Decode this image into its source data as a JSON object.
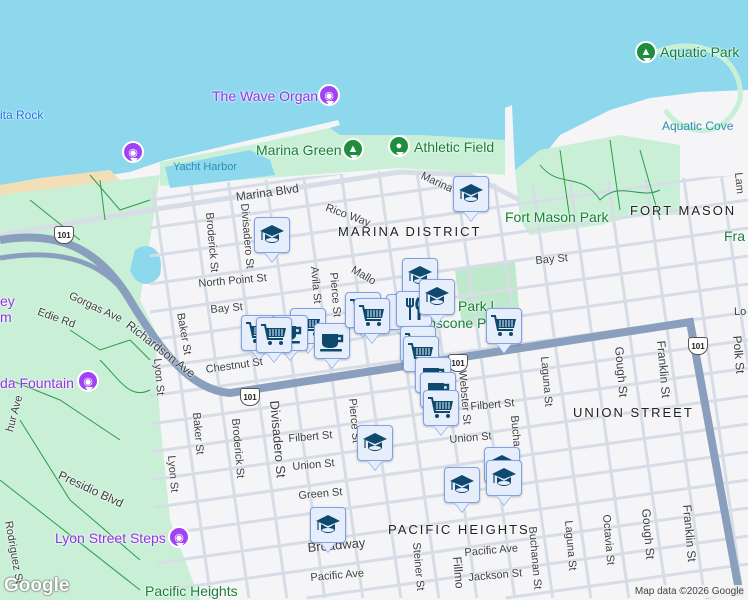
{
  "map": {
    "colors": {
      "water": "#8ed8ee",
      "land": "#f5f4f6",
      "park": "#c9f0d6",
      "street": "#d6dde6",
      "highway": "#8a9fbd",
      "marker_bg": "#e6edfb",
      "marker_border": "#7fa2e6",
      "marker_icon": "#0f4a6e"
    },
    "pois": {
      "bonita_rock": "ita Rock",
      "wave_organ": "The Wave Organ",
      "yacht_harbor": "Yacht Harbor",
      "marina_green": "Marina Green",
      "athletic_field": "Athletic Field",
      "aquatic_park": "Aquatic Park",
      "aquatic_cove": "Aquatic Cove",
      "fort_mason_park": "Fort Mason Park",
      "fra": "Fra",
      "moscone_1": "Park l",
      "moscone_2": "oscone P",
      "palace_1": "ey",
      "palace_2": "m",
      "fountain": "da Fountain",
      "lyon_steps": "Lyon Street Steps",
      "pacific_heights_park": "Pacific Heights"
    },
    "districts": {
      "fort_mason": "FORT MASON",
      "marina": "MARINA DISTRICT",
      "union_street": "UNION STREET",
      "pacific_heights": "PACIFIC HEIGHTS"
    },
    "streets": {
      "marina_blvd": "Marina Blvd",
      "marina_e": "Marina",
      "rico_way": "Rico Way",
      "broderick_n": "Broderick St",
      "divisadero_n": "Divisadero St",
      "north_point": "North Point St",
      "bay_w": "Bay St",
      "bay_e": "Bay St",
      "avila": "Avila St",
      "pierce_n": "Pierce St",
      "mallorca": "Mallo",
      "gorgas": "Gorgas Ave",
      "edie": "Edie Rd",
      "baker_n": "Baker St",
      "richardson": "Richardson Ave",
      "chestnut": "Chestnut St",
      "lyon_n": "Lyon St",
      "lyon_s": "Lyon St",
      "baker_s": "Baker St",
      "broderick_s": "Broderick St",
      "divisadero_s": "Divisadero St",
      "pierce_s": "Pierce St",
      "filbert_w": "Filbert St",
      "union_w": "Union St",
      "green": "Green St",
      "broadway": "Broadway",
      "pacific_w": "Pacific Ave",
      "pacific_e": "Pacific Ave",
      "jackson": "Jackson St",
      "steiner": "Steiner St",
      "fillmore": "Fillmo",
      "buchanan_s": "Buchanan St",
      "laguna_s": "Laguna St",
      "octavia": "Octavia St",
      "gough_s": "Gough St",
      "franklin_s": "Franklin St",
      "laguna_n": "Laguna St",
      "gough_n": "Gough St",
      "franklin_n": "Franklin St",
      "polk": "Polk St",
      "filbert_e": "Filbert St",
      "union_e": "Union St",
      "webster": "Webster St",
      "buchanan_n": "Bucha",
      "presidio": "Presidio Blvd",
      "arthur": "hur Ave",
      "rodriguez": "Rodriguez St",
      "lombard": "Lo",
      "laguna_top": "Lam"
    },
    "highway_shield": "101",
    "logo": "Google",
    "attribution": "Map data ©2026 Google"
  }
}
